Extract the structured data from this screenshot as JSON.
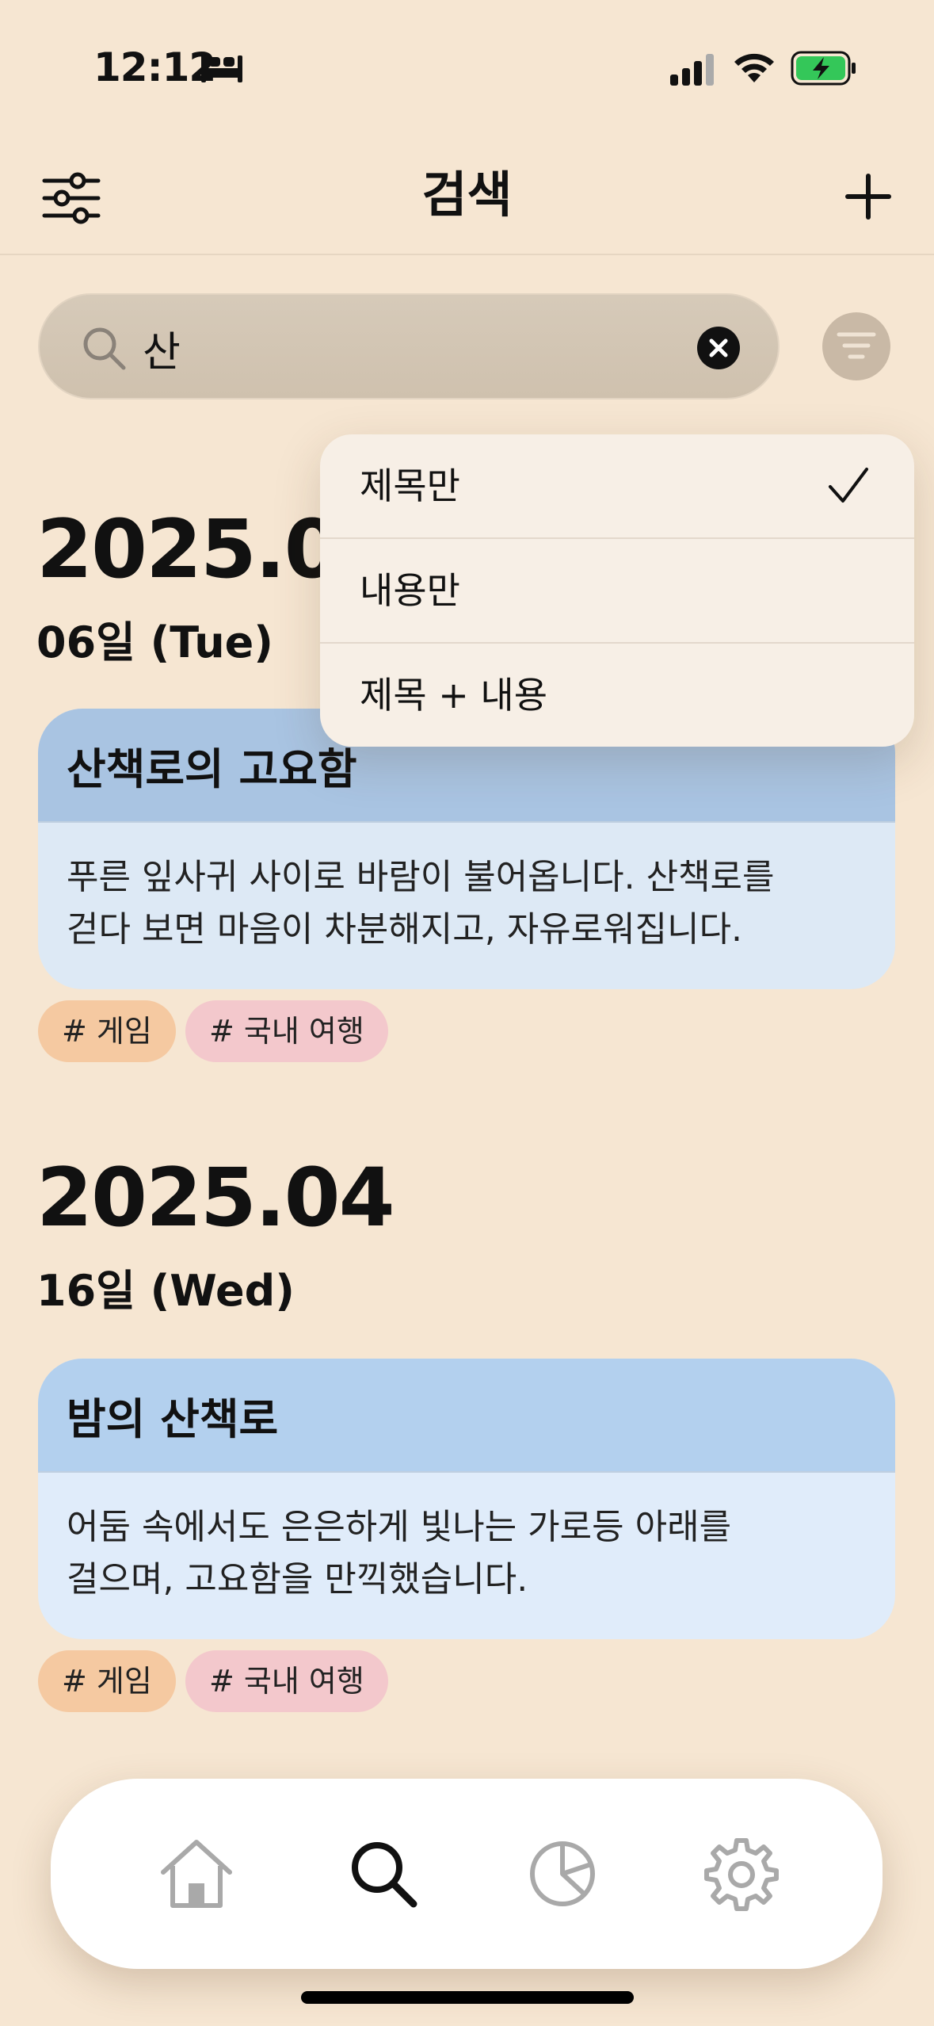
{
  "status_bar": {
    "time": "12:12",
    "icons": [
      "bed-icon",
      "signal-icon",
      "wifi-icon",
      "battery-charging-icon"
    ],
    "battery_color": "#34c759"
  },
  "nav": {
    "title": "검색",
    "left_icon": "filter-settings-icon",
    "right_icon": "add-icon"
  },
  "search": {
    "value": "산",
    "placeholder": ""
  },
  "dropdown": {
    "items": [
      {
        "label": "제목만",
        "checked": true
      },
      {
        "label": "내용만",
        "checked": false
      },
      {
        "label": "제목 + 내용",
        "checked": false
      }
    ]
  },
  "entries": [
    {
      "month": "2025.05",
      "day": "06일 (Tue)",
      "title": "산책로의 고요함",
      "body_line1": "푸른 잎사귀 사이로 바람이 불어옵니다. 산책로를",
      "body_line2": "걷다 보면 마음이 차분해지고, 자유로워집니다.",
      "tags": [
        "# 게임",
        "# 국내 여행"
      ]
    },
    {
      "month": "2025.04",
      "day": "16일 (Wed)",
      "title": "밤의 산책로",
      "body_line1": "어둠 속에서도 은은하게 빛나는 가로등 아래를",
      "body_line2": "걸으며, 고요함을 만끽했습니다.",
      "tags": [
        "# 게임",
        "# 국내 여행"
      ]
    }
  ],
  "tab_bar": {
    "tabs": [
      "home-icon",
      "search-icon",
      "chart-icon",
      "settings-icon"
    ],
    "active": "search-icon"
  }
}
